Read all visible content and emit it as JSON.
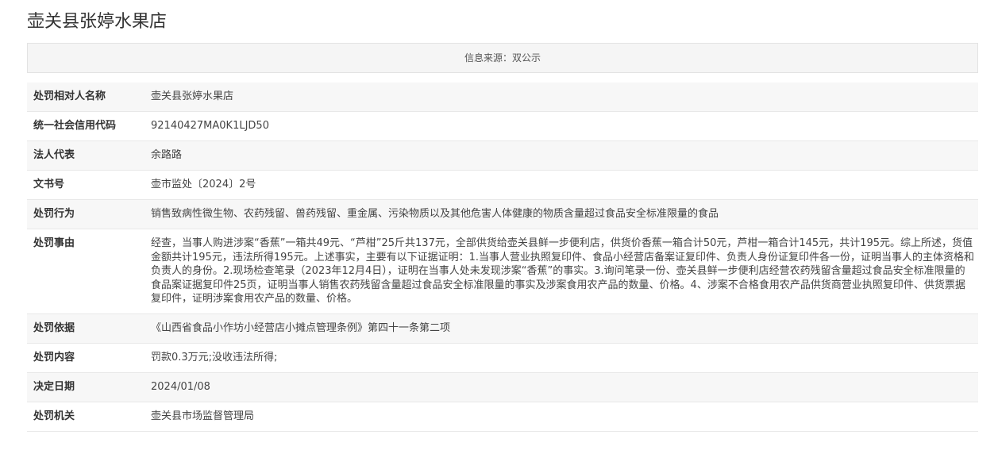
{
  "page": {
    "title": "壶关县张婷水果店",
    "source": "信息来源：双公示"
  },
  "details": [
    {
      "label": "处罚相对人名称",
      "value": "壶关县张婷水果店"
    },
    {
      "label": "统一社会信用代码",
      "value": "92140427MA0K1LJD50"
    },
    {
      "label": "法人代表",
      "value": "余路路"
    },
    {
      "label": "文书号",
      "value": "壶市监处〔2024〕2号"
    },
    {
      "label": "处罚行为",
      "value": "销售致病性微生物、农药残留、兽药残留、重金属、污染物质以及其他危害人体健康的物质含量超过食品安全标准限量的食品"
    },
    {
      "label": "处罚事由",
      "value": "经查，当事人购进涉案“香蕉”一箱共49元、“芦柑”25斤共137元，全部供货给壶关县鲜一步便利店，供货价香蕉一箱合计50元，芦柑一箱合计145元，共计195元。综上所述，货值金额共计195元，违法所得195元。上述事实，主要有以下证据证明：1.当事人营业执照复印件、食品小经营店备案证复印件、负责人身份证复印件各一份，证明当事人的主体资格和负责人的身份。2.现场检查笔录（2023年12月4日），证明在当事人处未发现涉案“香蕉”的事实。3.询问笔录一份、壶关县鲜一步便利店经营农药残留含量超过食品安全标准限量的食品案证据复印件25页，证明当事人销售农药残留含量超过食品安全标准限量的事实及涉案食用农产品的数量、价格。4、涉案不合格食用农产品供货商营业执照复印件、供货票据复印件，证明涉案食用农产品的数量、价格。"
    },
    {
      "label": "处罚依据",
      "value": "《山西省食品小作坊小经营店小摊点管理条例》第四十一条第二项"
    },
    {
      "label": "处罚内容",
      "value": "罚款0.3万元;没收违法所得;"
    },
    {
      "label": "决定日期",
      "value": "2024/01/08"
    },
    {
      "label": "处罚机关",
      "value": "壶关县市场监督管理局"
    }
  ]
}
